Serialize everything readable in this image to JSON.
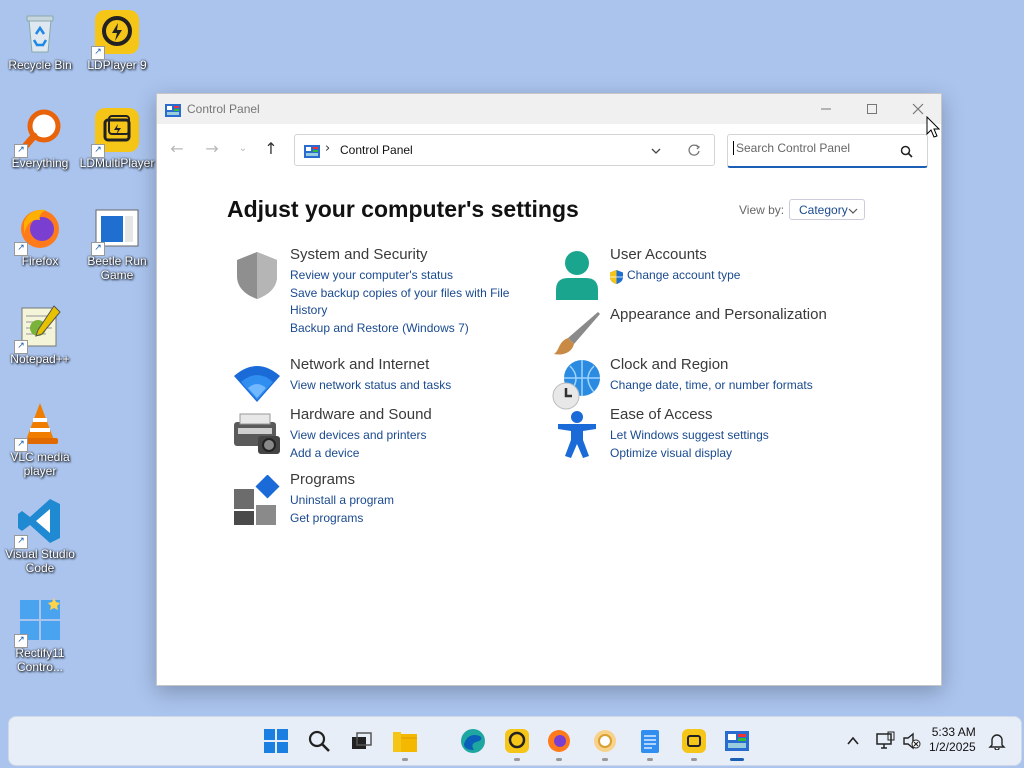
{
  "desktop": {
    "icons": [
      {
        "label": "Recycle Bin"
      },
      {
        "label": "LDPlayer 9"
      },
      {
        "label": "Everything"
      },
      {
        "label": "LDMultiPlayer"
      },
      {
        "label": "Firefox"
      },
      {
        "label": "Beetle Run Game"
      },
      {
        "label": "Notepad++"
      },
      {
        "label": "VLC media player"
      },
      {
        "label": "Visual Studio Code"
      },
      {
        "label": "Rectify11 Contro..."
      }
    ]
  },
  "window": {
    "title": "Control Panel",
    "address": {
      "breadcrumb": "Control Panel",
      "separator": "›"
    },
    "search": {
      "placeholder": "Search Control Panel"
    },
    "heading": "Adjust your computer's settings",
    "view_by_label": "View by:",
    "view_by_value": "Category",
    "categories_left": [
      {
        "title": "System and Security",
        "icon": "shield-icon",
        "links": [
          "Review your computer's status",
          "Save backup copies of your files with File History",
          "Backup and Restore (Windows 7)"
        ]
      },
      {
        "title": "Network and Internet",
        "icon": "wifi-icon",
        "links": [
          "View network status and tasks"
        ]
      },
      {
        "title": "Hardware and Sound",
        "icon": "printer-icon",
        "links": [
          "View devices and printers",
          "Add a device"
        ]
      },
      {
        "title": "Programs",
        "icon": "programs-icon",
        "links": [
          "Uninstall a program",
          "Get programs"
        ]
      }
    ],
    "categories_right": [
      {
        "title": "User Accounts",
        "icon": "user-icon",
        "links": [
          "Change account type"
        ]
      },
      {
        "title": "Appearance and Personalization",
        "icon": "paintbrush-icon",
        "links": []
      },
      {
        "title": "Clock and Region",
        "icon": "globe-clock-icon",
        "links": [
          "Change date, time, or number formats"
        ]
      },
      {
        "title": "Ease of Access",
        "icon": "accessibility-icon",
        "links": [
          "Let Windows suggest settings",
          "Optimize visual display"
        ]
      }
    ]
  },
  "taskbar": {
    "time": "5:33 AM",
    "date": "1/2/2025"
  },
  "colors": {
    "desktop": "#aac4ee",
    "link": "#1a4a8f",
    "accent": "#1a5fb4"
  }
}
